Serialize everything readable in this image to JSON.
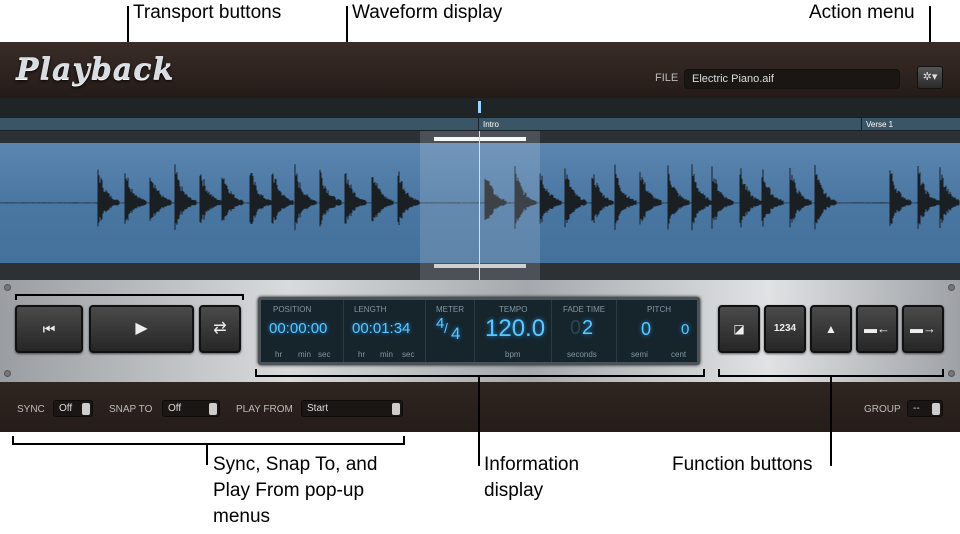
{
  "callouts": {
    "transport": "Transport buttons",
    "waveform": "Waveform display",
    "action_menu": "Action menu",
    "sync_snap_play": [
      "Sync, Snap To, and",
      "Play From pop-up",
      "menus"
    ],
    "information": [
      "Information",
      "display"
    ],
    "function": "Function buttons"
  },
  "header": {
    "logo": "Playback",
    "file_label": "FILE",
    "file_value": "Electric Piano.aif",
    "action_icon": "gear-icon"
  },
  "markers": [
    {
      "label": "Intro"
    },
    {
      "label": "Verse 1"
    }
  ],
  "transport": {
    "go_to_start_icon": "skip-back-icon",
    "play_icon": "play-icon",
    "loop_icon": "loop-icon"
  },
  "info": {
    "position": {
      "label": "POSITION",
      "value": "00:00:00",
      "units": [
        "hr",
        "min",
        "sec"
      ]
    },
    "length": {
      "label": "LENGTH",
      "value": "00:01:34",
      "units": [
        "hr",
        "min",
        "sec"
      ]
    },
    "meter": {
      "label": "METER",
      "numerator": "4",
      "denominator": "4"
    },
    "tempo": {
      "label": "TEMPO",
      "value": "120.0",
      "unit": "bpm"
    },
    "fade_time": {
      "label": "FADE TIME",
      "dim_digit": "0",
      "value": "2",
      "unit": "seconds"
    },
    "pitch": {
      "label": "PITCH",
      "semi": "0",
      "cent": "0",
      "semi_label": "semi",
      "cent_label": "cent"
    }
  },
  "function_buttons": {
    "count_in_label": "1234"
  },
  "bottom": {
    "sync_label": "SYNC",
    "sync_value": "Off",
    "snap_label": "SNAP TO",
    "snap_value": "Off",
    "play_from_label": "PLAY FROM",
    "play_from_value": "Start",
    "group_label": "GROUP",
    "group_value": "--"
  }
}
